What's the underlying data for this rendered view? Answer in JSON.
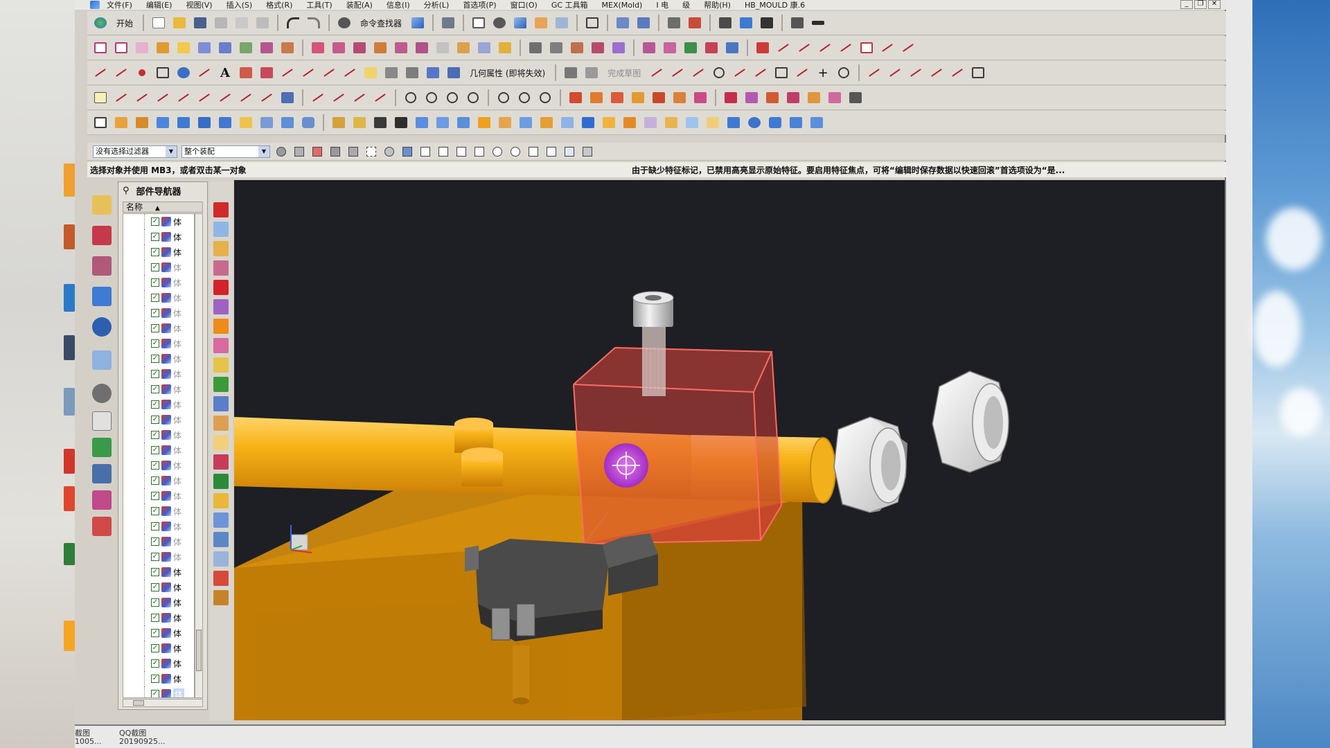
{
  "menubar": {
    "items": [
      "文件(F)",
      "编辑(E)",
      "视图(V)",
      "插入(S)",
      "格式(R)",
      "工具(T)",
      "装配(A)",
      "信息(I)",
      "分析(L)",
      "首选项(P)",
      "窗口(O)",
      "GC 工具箱",
      "MEX(Mold)",
      "I 电",
      "级",
      "帮助(H)",
      "HB_MOULD 康.6"
    ]
  },
  "toolbar1": {
    "start_label": "开始",
    "command_finder_label": "命令查找器"
  },
  "toolbar3": {
    "geometry_property_label": "几何属性 (即将失效)",
    "finish_sketch_label": "完成草图"
  },
  "filterbar": {
    "filter_value": "没有选择过滤器",
    "scope_value": "整个装配"
  },
  "status": {
    "left_text": "选择对象并使用 MB3，或者双击某一对象",
    "right_text": "由于缺少特征标记，已禁用高亮显示原始特征。要启用特征焦点，可将“编辑时保存数据以快速回滚”首选项设为“是..."
  },
  "navigator": {
    "title": "部件导航器",
    "column_header": "名称",
    "rows": [
      "体",
      "体",
      "体",
      "体",
      "体",
      "体",
      "体",
      "体",
      "体",
      "体",
      "体",
      "体",
      "体",
      "体",
      "体",
      "体",
      "体",
      "体",
      "体",
      "体",
      "体",
      "体",
      "体",
      "体",
      "体",
      "体",
      "体",
      "体",
      "体",
      "体",
      "体",
      "体"
    ],
    "dimmed_rows": [
      3,
      4,
      5,
      6,
      7,
      8,
      9,
      10,
      11,
      12,
      13,
      14,
      15,
      16,
      17,
      18,
      19,
      20,
      21,
      22
    ],
    "selected_row": 31
  },
  "taskbar": {
    "item1_top": "截图",
    "item1_bottom": "1005...",
    "item2_top": "QQ截图",
    "item2_bottom": "20190925..."
  },
  "colors": {
    "viewport_bg": "#1e1f24",
    "orange_part": "#f2a20c",
    "highlight_red": "#e2463c",
    "purple_cursor": "#b344d6"
  }
}
